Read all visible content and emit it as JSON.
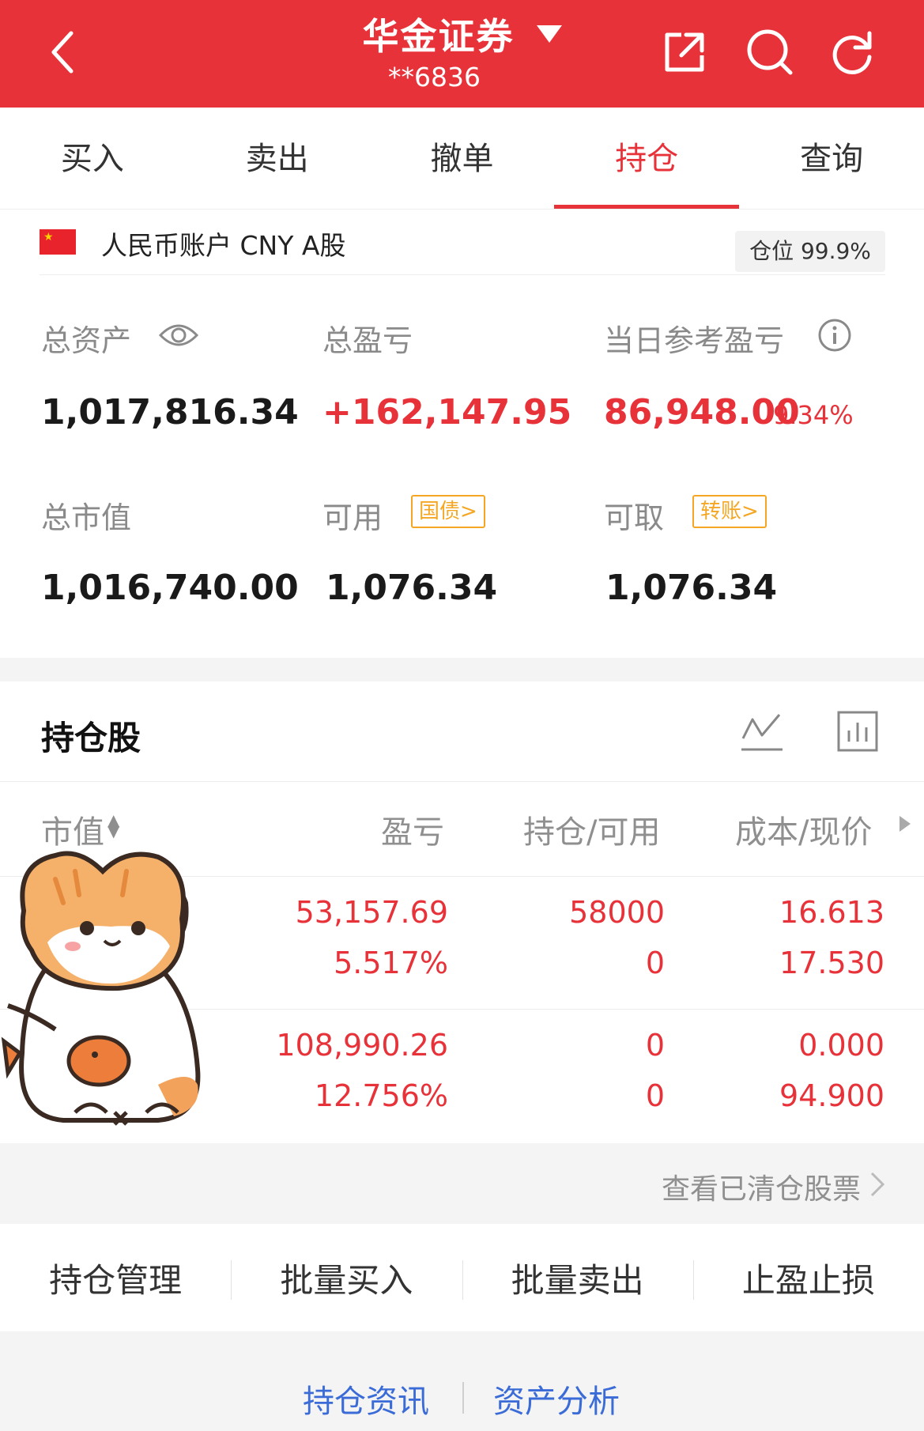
{
  "header": {
    "title": "华金证券",
    "account": "**6836",
    "icons": [
      "back-icon",
      "share-icon",
      "search-icon",
      "refresh-icon"
    ],
    "bg_color": "#e8323a"
  },
  "tabs": [
    {
      "label": "买入"
    },
    {
      "label": "卖出"
    },
    {
      "label": "撤单"
    },
    {
      "label": "持仓",
      "active": true
    },
    {
      "label": "查询"
    }
  ],
  "account_line": {
    "text": "人民币账户 CNY A股",
    "position_label": "仓位 99.9%"
  },
  "summary": {
    "total_assets_label": "总资产",
    "total_assets": "1,017,816.34",
    "total_pl_label": "总盈亏",
    "total_pl": "+162,147.95",
    "day_pl_label": "当日参考盈亏",
    "day_pl": "86,948.00",
    "day_pl_pct": "9.34%",
    "market_value_label": "总市值",
    "market_value": "1,016,740.00",
    "available_label": "可用",
    "available_tag": "国债>",
    "available": "1,076.34",
    "withdrawable_label": "可取",
    "withdrawable_tag": "转账>",
    "withdrawable": "1,076.34"
  },
  "holdings": {
    "title": "持仓股",
    "columns": [
      "市值",
      "盈亏",
      "持仓/可用",
      "成本/现价"
    ],
    "rows": [
      {
        "pl": "53,157.69",
        "pl_pct": "5.517%",
        "hold": "58000",
        "avail": "0",
        "cost": "16.613",
        "price": "17.530"
      },
      {
        "pl": "108,990.26",
        "pl_pct": "12.756%",
        "hold": "0",
        "avail": "0",
        "cost": "0.000",
        "price": "94.900"
      }
    ],
    "cleared_link": "查看已清仓股票"
  },
  "actions": [
    "持仓管理",
    "批量买入",
    "批量卖出",
    "止盈止损"
  ],
  "footer_links": [
    "持仓资讯",
    "资产分析"
  ]
}
